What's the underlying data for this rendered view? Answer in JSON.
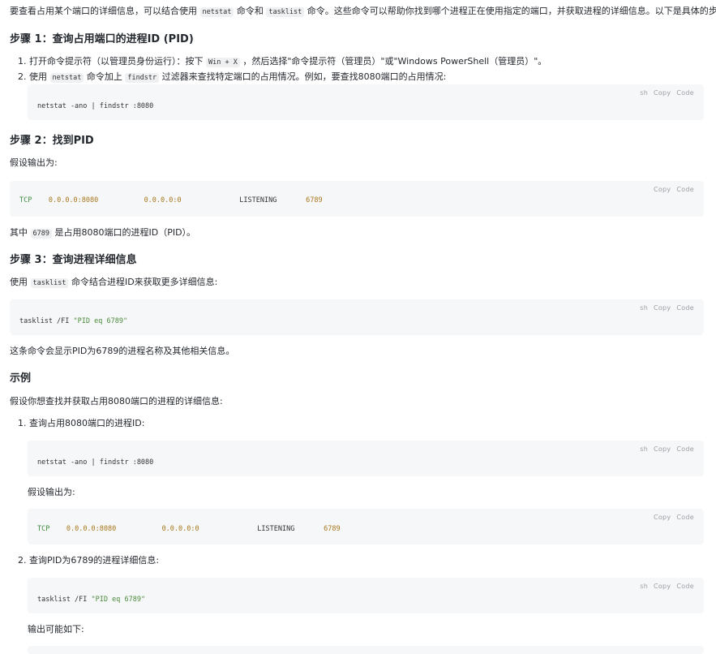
{
  "intro": {
    "p1": "要查看占用某个端口的详细信息，可以结合使用",
    "c1": "netstat",
    "p2": "命令和",
    "c2": "tasklist",
    "p3": "命令。这些命令可以帮助你找到哪个进程正在使用指定的端口，并获取进程的详细信息。以下是具体的步骤:"
  },
  "step1": {
    "title": "步骤 1：查询占用端口的进程ID (PID)",
    "item1_a": "1. 打开命令提示符（以管理员身份运行）：按下",
    "item1_key": "Win + X",
    "item1_b": "，然后选择\"命令提示符（管理员）\"或\"Windows PowerShell（管理员）\"。",
    "item2_a": "2. 使用",
    "item2_c1": "netstat",
    "item2_b": "命令加上",
    "item2_c2": "findstr",
    "item2_c": "过滤器来查找特定端口的占用情况。例如，要查找8080端口的占用情况:",
    "code": {
      "lang": "sh",
      "copy": "Copy",
      "code_label": "Code",
      "text": "netstat -ano | findstr :8080"
    }
  },
  "step2": {
    "title": "步骤 2：找到PID",
    "intro": "假设输出为:",
    "code": {
      "copy": "Copy",
      "code_label": "Code",
      "proto": "TCP",
      "local": "0.0.0.0:8080",
      "remote": "0.0.0.0:0",
      "state": "LISTENING",
      "pid": "6789"
    },
    "after_a": "其中",
    "after_c": "6789",
    "after_b": "是占用8080端口的进程ID（PID）。"
  },
  "step3": {
    "title": "步骤 3：查询进程详细信息",
    "intro_a": "使用",
    "intro_c": "tasklist",
    "intro_b": "命令结合进程ID来获取更多详细信息:",
    "code": {
      "lang": "sh",
      "copy": "Copy",
      "code_label": "Code",
      "cmd": "tasklist /FI ",
      "arg": "\"PID eq 6789\""
    },
    "after": "这条命令会显示PID为6789的进程名称及其他相关信息。"
  },
  "example": {
    "title": "示例",
    "intro": "假设你想查找并获取占用8080端口的进程的详细信息:",
    "item1": "1. 查询占用8080端口的进程ID:",
    "code1": {
      "lang": "sh",
      "copy": "Copy",
      "code_label": "Code",
      "text": "netstat -ano | findstr :8080"
    },
    "assume": "假设输出为:",
    "code2": {
      "copy": "Copy",
      "code_label": "Code",
      "proto": "TCP",
      "local": "0.0.0.0:8080",
      "remote": "0.0.0.0:0",
      "state": "LISTENING",
      "pid": "6789"
    },
    "item2": "2. 查询PID为6789的进程详细信息:",
    "code3": {
      "lang": "sh",
      "copy": "Copy",
      "code_label": "Code",
      "cmd": "tasklist /FI ",
      "arg": "\"PID eq 6789\""
    },
    "output": "输出可能如下:"
  },
  "colors": {
    "keyword": "#3f8d3f",
    "number": "#a8761d",
    "string": "#4b8a3c",
    "block_bg": "#f6f7f8"
  }
}
